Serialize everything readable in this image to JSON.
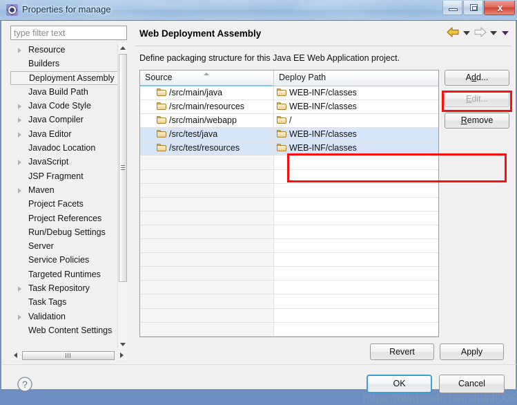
{
  "window": {
    "title": "Properties for manage",
    "icon": "eclipse-properties-icon",
    "minimize_label": "",
    "maximize_label": "",
    "close_label": "x"
  },
  "sidebar": {
    "filter": {
      "placeholder": "type filter text",
      "value": ""
    },
    "items": [
      {
        "label": "Resource",
        "expandable": true,
        "selected": false
      },
      {
        "label": "Builders",
        "expandable": false,
        "selected": false
      },
      {
        "label": "Deployment Assembly",
        "expandable": false,
        "selected": true
      },
      {
        "label": "Java Build Path",
        "expandable": false,
        "selected": false
      },
      {
        "label": "Java Code Style",
        "expandable": true,
        "selected": false
      },
      {
        "label": "Java Compiler",
        "expandable": true,
        "selected": false
      },
      {
        "label": "Java Editor",
        "expandable": true,
        "selected": false
      },
      {
        "label": "Javadoc Location",
        "expandable": false,
        "selected": false
      },
      {
        "label": "JavaScript",
        "expandable": true,
        "selected": false
      },
      {
        "label": "JSP Fragment",
        "expandable": false,
        "selected": false
      },
      {
        "label": "Maven",
        "expandable": true,
        "selected": false
      },
      {
        "label": "Project Facets",
        "expandable": false,
        "selected": false
      },
      {
        "label": "Project References",
        "expandable": false,
        "selected": false
      },
      {
        "label": "Run/Debug Settings",
        "expandable": false,
        "selected": false
      },
      {
        "label": "Server",
        "expandable": false,
        "selected": false
      },
      {
        "label": "Service Policies",
        "expandable": false,
        "selected": false
      },
      {
        "label": "Targeted Runtimes",
        "expandable": false,
        "selected": false
      },
      {
        "label": "Task Repository",
        "expandable": true,
        "selected": false
      },
      {
        "label": "Task Tags",
        "expandable": false,
        "selected": false
      },
      {
        "label": "Validation",
        "expandable": true,
        "selected": false
      },
      {
        "label": "Web Content Settings",
        "expandable": false,
        "selected": false
      }
    ]
  },
  "main": {
    "title": "Web Deployment Assembly",
    "description": "Define packaging structure for this Java EE Web Application project.",
    "nav": {
      "back_icon": "back-arrow-icon",
      "back_dropdown_icon": "chevron-down-icon",
      "forward_icon": "forward-arrow-icon",
      "forward_dropdown_icon": "chevron-down-icon",
      "menu_icon": "chevron-down-icon"
    },
    "table": {
      "columns": [
        "Source",
        "Deploy Path"
      ],
      "sort_column": "Source",
      "sort_direction": "asc",
      "rows": [
        {
          "source": "/src/main/java",
          "deploy": "WEB-INF/classes",
          "selected": false
        },
        {
          "source": "/src/main/resources",
          "deploy": "WEB-INF/classes",
          "selected": false
        },
        {
          "source": "/src/main/webapp",
          "deploy": "/",
          "selected": false
        },
        {
          "source": "/src/test/java",
          "deploy": "WEB-INF/classes",
          "selected": true
        },
        {
          "source": "/src/test/resources",
          "deploy": "WEB-INF/classes",
          "selected": true
        }
      ],
      "empty_row_count": 13
    },
    "side_buttons": [
      {
        "label": "Add...",
        "mnemonic_index": 1,
        "disabled": false,
        "highlighted": false
      },
      {
        "label": "Edit...",
        "mnemonic_index": 0,
        "disabled": true,
        "highlighted": false
      },
      {
        "label": "Remove",
        "mnemonic_index": 0,
        "disabled": false,
        "highlighted": true
      }
    ],
    "bottom_buttons": [
      {
        "label": "Revert",
        "mnemonic_index": 3
      },
      {
        "label": "Apply",
        "mnemonic_index": 0
      }
    ]
  },
  "footer": {
    "help_icon": "help-question-icon",
    "buttons": [
      {
        "label": "OK",
        "default": true
      },
      {
        "label": "Cancel",
        "default": false
      }
    ]
  },
  "watermark": {
    "text": "https://blog.csdn.net/shunli008"
  },
  "colors": {
    "highlight_red": "#fb0e0e",
    "selection_blue": "#d6e6f8",
    "accent_blue": "#3c9fd8",
    "folder_yellow": "#f6dfae"
  }
}
